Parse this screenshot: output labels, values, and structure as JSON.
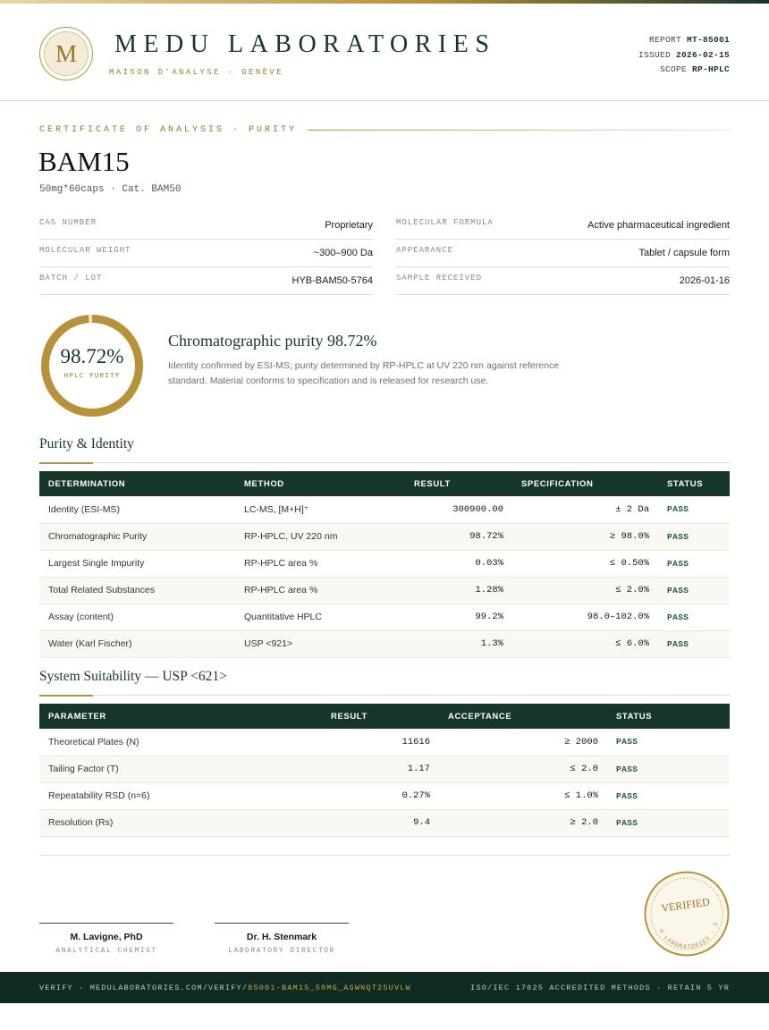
{
  "header": {
    "logo_letter": "M",
    "brand": "MEDU LABORATORIES",
    "tagline": "MAISON D'ANALYSE · GENÈVE",
    "report_label": "REPORT",
    "report_value": "MT-85001",
    "issued_label": "ISSUED",
    "issued_value": "2026-02-15",
    "scope_label": "SCOPE",
    "scope_value": "RP-HPLC"
  },
  "certificate": {
    "kicker": "CERTIFICATE OF ANALYSIS · PURITY",
    "product": "BAM15",
    "subtitle": "50mg*60caps  ·  Cat. BAM50"
  },
  "properties": [
    {
      "label": "CAS NUMBER",
      "value": "Proprietary"
    },
    {
      "label": "MOLECULAR FORMULA",
      "value": "Active pharmaceutical ingredient"
    },
    {
      "label": "MOLECULAR WEIGHT",
      "value": "~300–900 Da"
    },
    {
      "label": "APPEARANCE",
      "value": "Tablet / capsule form"
    },
    {
      "label": "BATCH / LOT",
      "value": "HYB-BAM50-5764"
    },
    {
      "label": "SAMPLE RECEIVED",
      "value": "2026-01-16"
    }
  ],
  "summary": {
    "purity_display": "98.72%",
    "purity_fraction": 0.9872,
    "ring_label": "HPLC PURITY",
    "title": "Chromatographic purity 98.72%",
    "text": "Identity confirmed by ESI-MS; purity determined by RP-HPLC at UV 220 nm against reference standard. Material conforms to specification and is released for research use."
  },
  "purity_section": {
    "title": "Purity & Identity",
    "headers": [
      "DETERMINATION",
      "METHOD",
      "RESULT",
      "SPECIFICATION",
      "STATUS"
    ],
    "rows": [
      [
        "Identity (ESI-MS)",
        "LC-MS, [M+H]⁺",
        "300900.00",
        "± 2 Da",
        "PASS"
      ],
      [
        "Chromatographic Purity",
        "RP-HPLC, UV 220 nm",
        "98.72%",
        "≥ 98.0%",
        "PASS"
      ],
      [
        "Largest Single Impurity",
        "RP-HPLC area %",
        "0.03%",
        "≤ 0.50%",
        "PASS"
      ],
      [
        "Total Related Substances",
        "RP-HPLC area %",
        "1.28%",
        "≤ 2.0%",
        "PASS"
      ],
      [
        "Assay (content)",
        "Quantitative HPLC",
        "99.2%",
        "98.0–102.0%",
        "PASS"
      ],
      [
        "Water (Karl Fischer)",
        "USP <921>",
        "1.3%",
        "≤ 6.0%",
        "PASS"
      ]
    ]
  },
  "suitability_section": {
    "title": "System Suitability — USP <621>",
    "headers": [
      "PARAMETER",
      "RESULT",
      "ACCEPTANCE",
      "STATUS"
    ],
    "rows": [
      [
        "Theoretical Plates (N)",
        "11616",
        "≥ 2000",
        "PASS"
      ],
      [
        "Tailing Factor (T)",
        "1.17",
        "≤ 2.0",
        "PASS"
      ],
      [
        "Repeatability RSD (n=6)",
        "0.27%",
        "≤ 1.0%",
        "PASS"
      ],
      [
        "Resolution (Rs)",
        "9.4",
        "≥ 2.0",
        "PASS"
      ]
    ]
  },
  "signatures": [
    {
      "name": "M. Lavigne, PhD",
      "role": "ANALYTICAL CHEMIST"
    },
    {
      "name": "Dr. H. Stenmark",
      "role": "LABORATORY DIRECTOR"
    }
  ],
  "seal": {
    "word": "VERIFIED",
    "ring_text": "MEDU LABORATORIES · 2026"
  },
  "footer": {
    "verify_prefix": "VERIFY · MEDULABORATORIES.COM/VERIFY/",
    "verify_code": "85001-BAM15_50MG_ASWNQT25UVLW",
    "right": "ISO/IEC 17025 ACCREDITED METHODS · RETAIN 5 YR"
  },
  "colors": {
    "brand_green": "#17362a",
    "gold": "#b8923a",
    "pass_green": "#1e5a3c"
  }
}
